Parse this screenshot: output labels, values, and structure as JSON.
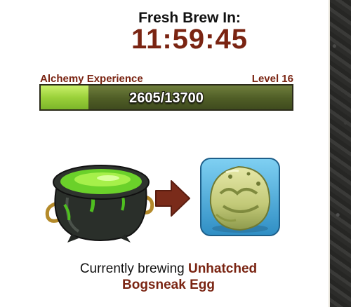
{
  "brew": {
    "title": "Fresh Brew In:",
    "timer": "11:59:45"
  },
  "experience": {
    "label": "Alchemy Experience",
    "level": "Level 16",
    "current": 2605,
    "max": 13700,
    "text": "2605/13700",
    "fill_fraction": 0.19
  },
  "recipe": {
    "source_icon": "cauldron-icon",
    "arrow_icon": "arrow-right-icon",
    "result_icon": "bogsneak-egg-icon"
  },
  "status": {
    "prefix": "Currently brewing ",
    "item_line1": "Unhatched",
    "item_line2": "Bogsneak Egg"
  },
  "colors": {
    "accent": "#7a2412",
    "bar_fill": "#9bd13a",
    "bar_track": "#4f5d26"
  }
}
